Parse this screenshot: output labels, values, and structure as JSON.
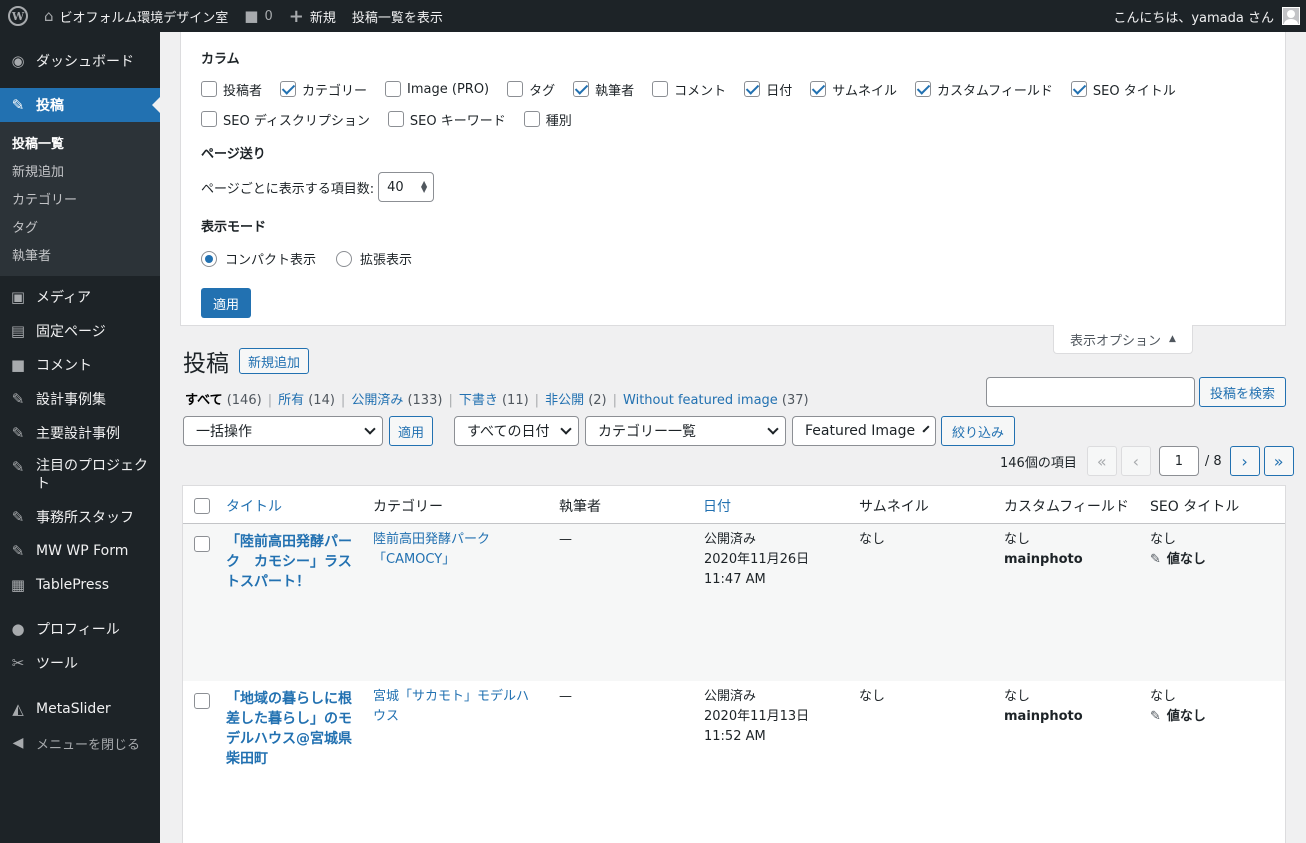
{
  "adminbar": {
    "wp_logo": "wordpress-logo",
    "site_name": "ビオフォルム環境デザイン室",
    "comments_count": "0",
    "new_label": "新規",
    "view_posts": "投稿一覧を表示",
    "greeting": "こんにちは、yamada さん"
  },
  "sidebar": {
    "dashboard": "ダッシュボード",
    "posts": "投稿",
    "submenu": [
      "投稿一覧",
      "新規追加",
      "カテゴリー",
      "タグ",
      "執筆者"
    ],
    "media": "メディア",
    "pages": "固定ページ",
    "comments": "コメント",
    "item_design_cases": "設計事例集",
    "item_major_cases": "主要設計事例",
    "item_featured": "注目のプロジェクト",
    "item_staff": "事務所スタッフ",
    "item_mwwp": "MW WP Form",
    "item_tablepress": "TablePress",
    "profile": "プロフィール",
    "tools": "ツール",
    "metaslider": "MetaSlider",
    "collapse": "メニューを閉じる"
  },
  "screen_options": {
    "columns_heading": "カラム",
    "columns": [
      {
        "label": "投稿者",
        "checked": false
      },
      {
        "label": "カテゴリー",
        "checked": true
      },
      {
        "label": "Image (PRO)",
        "checked": false
      },
      {
        "label": "タグ",
        "checked": false
      },
      {
        "label": "執筆者",
        "checked": true
      },
      {
        "label": "コメント",
        "checked": false
      },
      {
        "label": "日付",
        "checked": true
      },
      {
        "label": "サムネイル",
        "checked": true
      },
      {
        "label": "カスタムフィールド",
        "checked": true
      },
      {
        "label": "SEO タイトル",
        "checked": true
      },
      {
        "label": "SEO ディスクリプション",
        "checked": false
      },
      {
        "label": "SEO キーワード",
        "checked": false
      },
      {
        "label": "種別",
        "checked": false
      }
    ],
    "pagination_heading": "ページ送り",
    "per_page_label": "ページごとに表示する項目数:",
    "per_page_value": "40",
    "view_mode_heading": "表示モード",
    "view_compact": "コンパクト表示",
    "view_extended": "拡張表示",
    "apply": "適用",
    "tab_label": "表示オプション"
  },
  "page": {
    "title": "投稿",
    "add_new": "新規追加"
  },
  "filters": {
    "all": "すべて",
    "all_count": "(146)",
    "mine": "所有",
    "mine_count": "(14)",
    "publish": "公開済み",
    "publish_count": "(133)",
    "draft": "下書き",
    "draft_count": "(11)",
    "private": "非公開",
    "private_count": "(2)",
    "no_image": "Without featured image",
    "no_image_count": "(37)"
  },
  "search": {
    "button": "投稿を検索",
    "placeholder": ""
  },
  "tablenav": {
    "bulk": "一括操作",
    "apply": "適用",
    "dates": "すべての日付",
    "categories": "カテゴリー一覧",
    "featured": "Featured Image",
    "filter": "絞り込み",
    "items_count": "146個の項目",
    "first": "«",
    "prev": "‹",
    "current_page": "1",
    "total_pages": "/ 8",
    "next": "›",
    "last": "»"
  },
  "table": {
    "headers": {
      "title": "タイトル",
      "category": "カテゴリー",
      "author": "執筆者",
      "date": "日付",
      "thumbnail": "サムネイル",
      "custom_field": "カスタムフィールド",
      "seo_title": "SEO タイトル"
    },
    "rows": [
      {
        "title": "「陸前高田発酵パーク　カモシー」ラストスパート！",
        "category": "陸前高田発酵パーク「CAMOCY」",
        "author": "—",
        "status": "公開済み",
        "date": "2020年11月26日 11:47 AM",
        "thumbnail": "なし",
        "cf_value": "なし",
        "cf_key": "mainphoto",
        "seo_top": "なし",
        "seo_value": "値なし"
      },
      {
        "title": "「地域の暮らしに根差した暮らし」のモデルハウス@宮城県柴田町",
        "category": "宮城「サカモト」モデルハウス",
        "author": "—",
        "status": "公開済み",
        "date": "2020年11月13日 11:52 AM",
        "thumbnail": "なし",
        "cf_value": "なし",
        "cf_key": "mainphoto",
        "seo_top": "なし",
        "seo_value": "値なし"
      }
    ]
  }
}
